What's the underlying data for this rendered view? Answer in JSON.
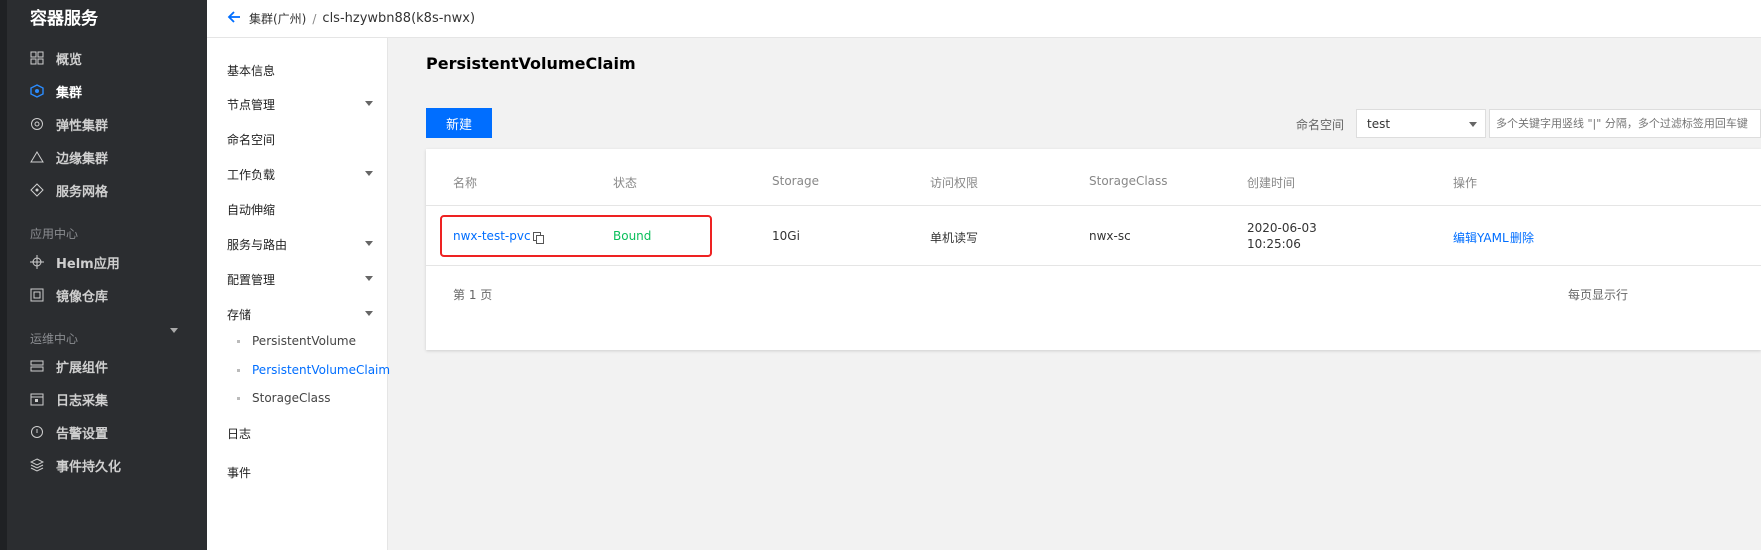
{
  "leftnav": {
    "brand": "容器服务",
    "items": [
      {
        "label": "概览",
        "icon": "grid-icon"
      },
      {
        "label": "集群",
        "icon": "cluster-icon",
        "active": true
      },
      {
        "label": "弹性集群",
        "icon": "elastic-cluster-icon"
      },
      {
        "label": "边缘集群",
        "icon": "edge-cluster-icon"
      },
      {
        "label": "服务网格",
        "icon": "mesh-icon"
      }
    ],
    "section_app": "应用中心",
    "app_items": [
      {
        "label": "Helm应用",
        "icon": "helm-icon"
      },
      {
        "label": "镜像仓库",
        "icon": "registry-icon"
      }
    ],
    "section_ops": "运维中心",
    "ops_items": [
      {
        "label": "扩展组件",
        "icon": "addon-icon"
      },
      {
        "label": "日志采集",
        "icon": "log-icon"
      },
      {
        "label": "告警设置",
        "icon": "alarm-icon"
      },
      {
        "label": "事件持久化",
        "icon": "event-icon"
      }
    ]
  },
  "topbar": {
    "back_icon": "arrow-left-icon",
    "crumb1": "集群(广州)",
    "sep": "/",
    "crumb2": "cls-hzywbn88(k8s-nwx)"
  },
  "submenu": {
    "items": [
      "基本信息",
      "节点管理",
      "命名空间",
      "工作负载",
      "自动伸缩",
      "服务与路由",
      "配置管理",
      "存储"
    ],
    "storage_children": [
      "PersistentVolume",
      "PersistentVolumeClaim",
      "StorageClass"
    ],
    "after": [
      "日志",
      "事件"
    ]
  },
  "main": {
    "title": "PersistentVolumeClaim",
    "new_button": "新建",
    "namespace_label": "命名空间",
    "namespace_value": "test",
    "search_placeholder": "多个关键字用竖线 \"|\" 分隔，多个过滤标签用回车键",
    "table": {
      "headers": [
        "名称",
        "状态",
        "Storage",
        "访问权限",
        "StorageClass",
        "创建时间",
        "操作"
      ],
      "row": {
        "name": "nwx-test-pvc",
        "status": "Bound",
        "storage": "10Gi",
        "access": "单机读写",
        "storage_class": "nwx-sc",
        "created_date": "2020-06-03",
        "created_time": "10:25:06",
        "action_edit": "编辑YAML",
        "action_delete": "删除"
      }
    },
    "pager": "第 1 页",
    "per_page": "每页显示行"
  },
  "colors": {
    "accent": "#006eff",
    "bound": "#0abf5b",
    "highlight": "#ee2222"
  }
}
